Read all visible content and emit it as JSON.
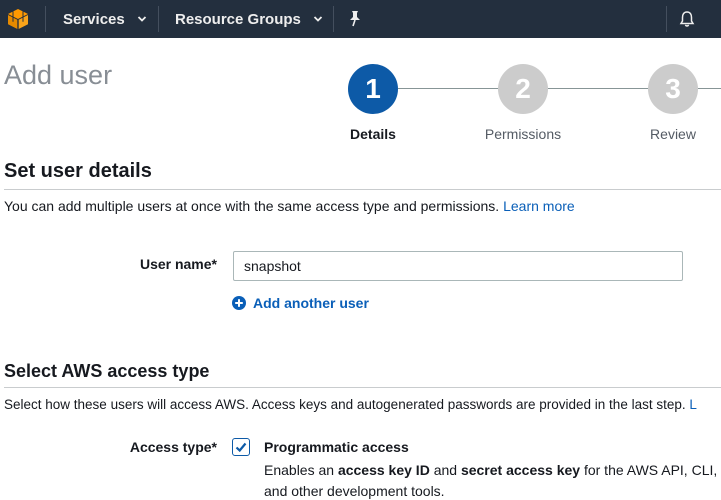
{
  "nav": {
    "logo_icon": "aws-cube-icon",
    "services_label": "Services",
    "resource_groups_label": "Resource Groups",
    "pin_icon": "pin-icon",
    "bell_icon": "bell-icon",
    "bg_color": "#232f3e",
    "logo_color": "#f90"
  },
  "page": {
    "title": "Add user"
  },
  "steps": [
    {
      "number": "1",
      "label": "Details",
      "state": "active"
    },
    {
      "number": "2",
      "label": "Permissions",
      "state": "inactive"
    },
    {
      "number": "3",
      "label": "Review",
      "state": "inactive"
    }
  ],
  "user_details": {
    "title": "Set user details",
    "description": "You can add multiple users at once with the same access type and permissions.",
    "learn_more": "Learn more",
    "username_label": "User name*",
    "username_value": "snapshot",
    "add_another_label": "Add another user"
  },
  "access_type": {
    "title": "Select AWS access type",
    "description": "Select how these users will access AWS. Access keys and autogenerated passwords are provided in the last step.",
    "description_link": "L",
    "field_label": "Access type*",
    "option": {
      "checked": true,
      "title": "Programmatic access",
      "desc_part1": "Enables an ",
      "desc_bold1": "access key ID",
      "desc_part2": " and ",
      "desc_bold2": "secret access key",
      "desc_part3": " for the AWS API, CLI,",
      "desc_line2": "and other development tools."
    }
  },
  "colors": {
    "accent_blue": "#0d5aa7",
    "link_blue": "#0a5fb8"
  }
}
